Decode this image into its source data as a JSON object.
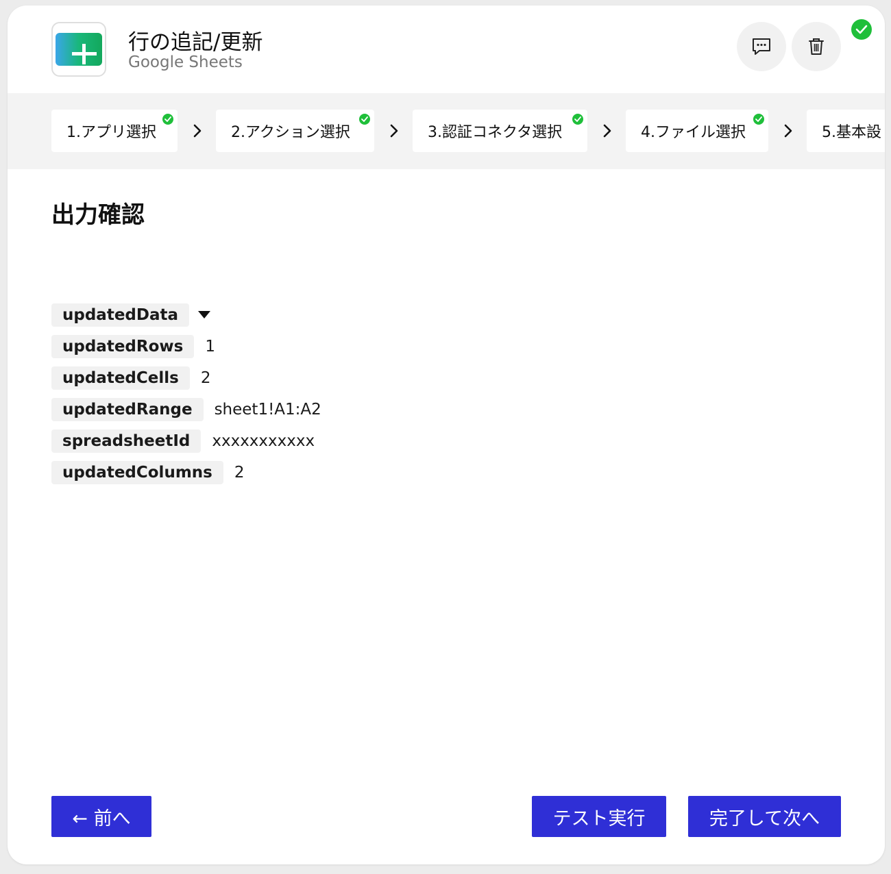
{
  "header": {
    "title": "行の追記/更新",
    "subtitle": "Google Sheets",
    "app_icon": "google-sheets-icon",
    "comment_icon": "comment-icon",
    "trash_icon": "trash-icon",
    "status": "complete"
  },
  "steps": [
    {
      "label": "1.アプリ選択",
      "completed": true
    },
    {
      "label": "2.アクション選択",
      "completed": true
    },
    {
      "label": "3.認証コネクタ選択",
      "completed": true
    },
    {
      "label": "4.ファイル選択",
      "completed": true
    },
    {
      "label": "5.基本設",
      "completed": false
    }
  ],
  "section": {
    "title": "出力確認"
  },
  "outputs": [
    {
      "key": "updatedData",
      "value": "",
      "expandable": true
    },
    {
      "key": "updatedRows",
      "value": "1"
    },
    {
      "key": "updatedCells",
      "value": "2"
    },
    {
      "key": "updatedRange",
      "value": "sheet1!A1:A2"
    },
    {
      "key": "spreadsheetId",
      "value": "xxxxxxxxxxx"
    },
    {
      "key": "updatedColumns",
      "value": "2"
    }
  ],
  "buttons": {
    "prev": "← 前へ",
    "test": "テスト実行",
    "next": "完了して次へ"
  },
  "colors": {
    "primary_button": "#2f2fd6",
    "success": "#1fbf3a",
    "steps_bg": "#f3f3f3",
    "key_bg": "#f1f1f1"
  }
}
